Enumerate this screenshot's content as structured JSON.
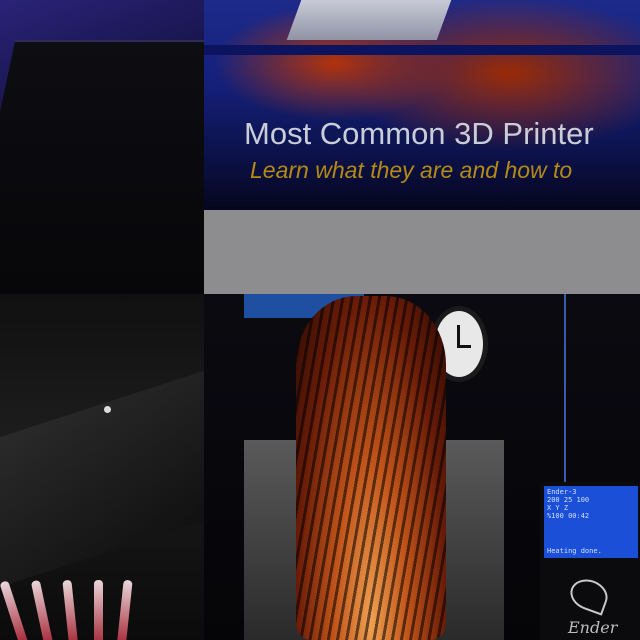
{
  "banner": {
    "title": "Most Common 3D Printer",
    "subtitle": "Learn what they are and how to"
  },
  "lcd": {
    "line1": "Ender-3",
    "line2": "200  25  100",
    "line3": "X  Y  Z",
    "line4": "%100  00:42",
    "status": "Heating done."
  },
  "logo": {
    "text": "Ender"
  },
  "colors": {
    "banner_blue": "#14207a",
    "subtitle_gold": "#b38a16",
    "lcd_blue": "#1c4fd8"
  }
}
